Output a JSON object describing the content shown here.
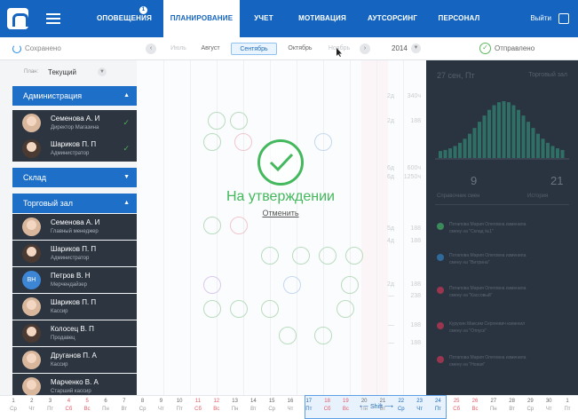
{
  "topbar": {
    "tabs": [
      {
        "label": "ОПОВЕЩЕНИЯ",
        "badge": "1"
      },
      {
        "label": "ПЛАНИРОВАНИЕ",
        "active": true
      },
      {
        "label": "УЧЕТ"
      },
      {
        "label": "МОТИВАЦИЯ"
      },
      {
        "label": "АУТСОРСИНГ"
      },
      {
        "label": "ПЕРСОНАЛ"
      }
    ],
    "exit_label": "Выйти"
  },
  "subbar": {
    "saved_label": "Сохранено",
    "months": [
      "Июль",
      "Август",
      "Сентябрь",
      "Октябрь",
      "Ноябрь"
    ],
    "active_month": "Сентябрь",
    "prev_arrow": "‹",
    "next_arrow": "›",
    "year": "2014",
    "sent_label": "Отправлено"
  },
  "left": {
    "plan_label": "План:",
    "plan_value": "Текущий",
    "groups": [
      {
        "title": "Администрация",
        "employees": [
          {
            "name": "Семенова А. И",
            "role": "Директор Магазина"
          },
          {
            "name": "Шариков П. П",
            "role": "Администратор"
          }
        ]
      },
      {
        "title": "Склад",
        "employees": []
      },
      {
        "title": "Торговый зал",
        "employees": [
          {
            "name": "Семенова А. И",
            "role": "Главный менеджер"
          },
          {
            "name": "Шариков П. П",
            "role": "Администратор"
          },
          {
            "name": "Петров В. Н",
            "role": "Мерчендайзер",
            "initials": "ВН"
          },
          {
            "name": "Шариков П. П",
            "role": "Кассир"
          },
          {
            "name": "Колосец В. П",
            "role": "Продавец"
          },
          {
            "name": "Друганов П. А",
            "role": "Кассир"
          },
          {
            "name": "Марченко В. А",
            "role": "Старший кассир"
          }
        ]
      }
    ]
  },
  "overlay": {
    "status": "На утверждении",
    "cancel": "Отменить"
  },
  "right": {
    "date": "27 сен, Пт",
    "zone": "Торговый зал",
    "left_value": "9",
    "right_value": "21",
    "tab1": "Справочник смен",
    "tab2": "История",
    "comments": [
      {
        "color": "#3a8a5a",
        "line1": "Потапова Мария Олеговна изменила",
        "line2": "смену на \"Склад №1\""
      },
      {
        "color": "#2f6a9a",
        "line1": "Потапова Мария Олеговна изменила",
        "line2": "смену на \"Витрина\""
      },
      {
        "color": "#9a3550",
        "line1": "Потапова Мария Олеговна изменила",
        "line2": "смену на \"Кассовый\""
      },
      {
        "color": "#9a3550",
        "line1": "Курухин Максим Сергеевич изменил",
        "line2": "смену на \"Отпуск\""
      },
      {
        "color": "#9a3550",
        "line1": "Потапова Мария Олеговна изменила",
        "line2": "смену на \"Новая\""
      }
    ]
  },
  "days": [
    {
      "n": "1",
      "w": "Ср"
    },
    {
      "n": "2",
      "w": "Чт"
    },
    {
      "n": "3",
      "w": "Пт"
    },
    {
      "n": "4",
      "w": "Сб",
      "we": true
    },
    {
      "n": "5",
      "w": "Вс",
      "we": true
    },
    {
      "n": "6",
      "w": "Пн"
    },
    {
      "n": "7",
      "w": "Вт"
    },
    {
      "n": "8",
      "w": "Ср"
    },
    {
      "n": "9",
      "w": "Чт"
    },
    {
      "n": "10",
      "w": "Пт"
    },
    {
      "n": "11",
      "w": "Сб",
      "we": true
    },
    {
      "n": "12",
      "w": "Вс",
      "we": true
    },
    {
      "n": "13",
      "w": "Пн"
    },
    {
      "n": "14",
      "w": "Вт"
    },
    {
      "n": "15",
      "w": "Ср"
    },
    {
      "n": "16",
      "w": "Чт"
    },
    {
      "n": "17",
      "w": "Пт",
      "sel": true
    },
    {
      "n": "18",
      "w": "Сб",
      "we": true
    },
    {
      "n": "19",
      "w": "Вс",
      "we": true
    },
    {
      "n": "20",
      "w": "Пн"
    },
    {
      "n": "21",
      "w": "Вт"
    },
    {
      "n": "22",
      "w": "Ср",
      "sel": true
    },
    {
      "n": "23",
      "w": "Чт",
      "sel": true
    },
    {
      "n": "24",
      "w": "Пт",
      "sel": true
    },
    {
      "n": "25",
      "w": "Сб",
      "we": true
    },
    {
      "n": "26",
      "w": "Вс",
      "we": true
    },
    {
      "n": "27",
      "w": "Пн"
    },
    {
      "n": "28",
      "w": "Вт"
    },
    {
      "n": "29",
      "w": "Ср"
    },
    {
      "n": "30",
      "w": "Чт"
    },
    {
      "n": "1",
      "w": "Пт"
    }
  ],
  "shift_label": "⟵ Shift ⟶",
  "grid": {
    "totals": [
      "2д",
      "340ч",
      "2д",
      "188",
      "6д",
      "600ч",
      "6д",
      "1250ч",
      "5д",
      "188",
      "4д",
      "188",
      "2д",
      "188",
      "—",
      "238",
      "—",
      "188",
      "—",
      "188"
    ]
  },
  "colors": {
    "brand": "#1565c0",
    "approved": "#43b85c",
    "panel": "#2a3441"
  }
}
